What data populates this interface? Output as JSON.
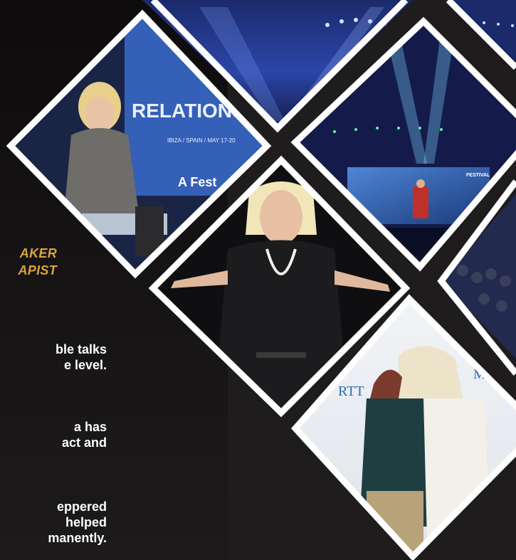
{
  "subtitle": {
    "line1": "AKER",
    "line2": "APIST"
  },
  "paragraphs": [
    {
      "line1": "ble talks",
      "line2": "e level."
    },
    {
      "line1": "a has",
      "line2": "act and"
    },
    {
      "line1": "eppered",
      "line2": "helped",
      "line3": "manently."
    }
  ],
  "photos": {
    "speaker_left": {
      "screen_text_1": "RELATIONSHI",
      "screen_text_2": "IBIZA / SPAIN / MAY 17-20",
      "logo_text": "A Fest"
    },
    "stage_screen": {
      "screen_text": "FESTIVAL"
    },
    "hug": {
      "banner_left": "RTT",
      "banner_right": "MATIO"
    }
  },
  "colors": {
    "accent": "#d9a53a",
    "border": "#ffffff",
    "background": "#1a1717"
  }
}
